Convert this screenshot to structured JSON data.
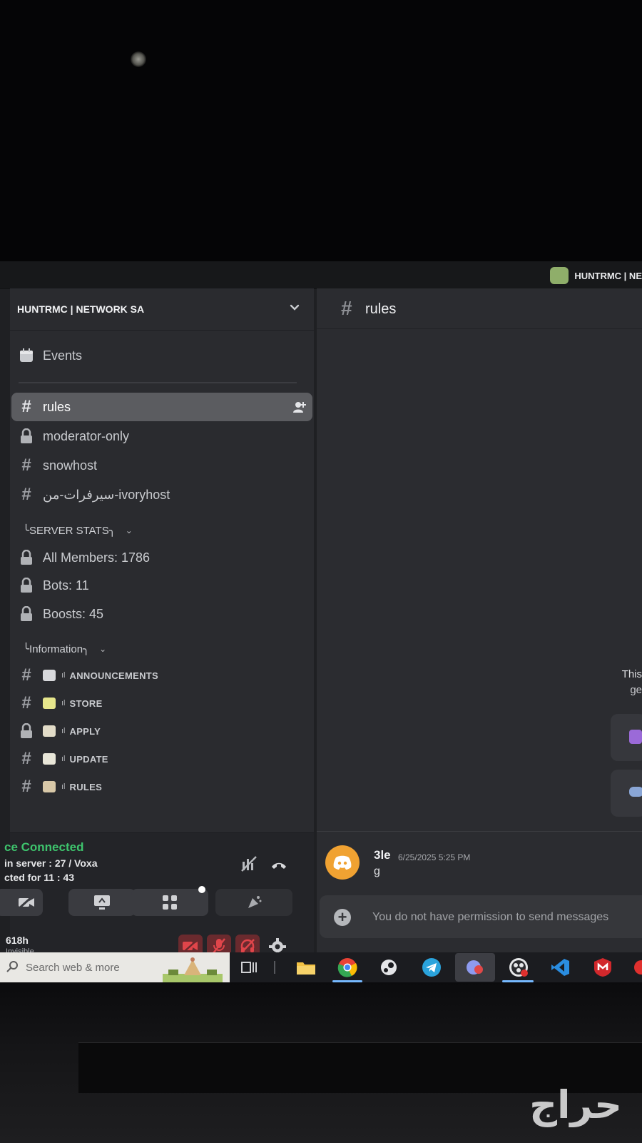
{
  "server": {
    "name": "HUNTRMC | NETWORK SA",
    "topbar_name": "HUNTRMC | NE"
  },
  "sidebar": {
    "events_label": "Events",
    "channels": [
      {
        "label": "rules",
        "icon": "hash-icon",
        "active": true
      },
      {
        "label": "moderator-only",
        "icon": "lock-icon"
      },
      {
        "label": "snowhost",
        "icon": "hash-icon"
      },
      {
        "label": "سيرفرات-من-ivoryhost",
        "icon": "hash-icon"
      }
    ],
    "categories": {
      "server_stats": "╰SERVER STATS╮",
      "information": "╰Information╮"
    },
    "stats": [
      {
        "label": "All Members: 1786",
        "icon": "lock-icon"
      },
      {
        "label": "Bots: 11",
        "icon": "lock-icon"
      },
      {
        "label": "Boosts: 45",
        "icon": "lock-icon"
      }
    ],
    "info_channels": [
      {
        "label": "ANNOUNCEMENTS",
        "icon": "hash-icon",
        "emoji": "megaphone-icon"
      },
      {
        "label": "STORE",
        "icon": "hash-icon",
        "emoji": "sparkle-icon"
      },
      {
        "label": "APPLY",
        "icon": "lock-icon",
        "emoji": "pencil-icon"
      },
      {
        "label": "UPDATE",
        "icon": "hash-icon",
        "emoji": "notepad-icon"
      },
      {
        "label": "RULES",
        "icon": "hash-icon",
        "emoji": "clipboard-icon"
      }
    ],
    "bars_glyph": "ıl"
  },
  "voice": {
    "title": "ce Connected",
    "subtitle": "in server : 27 / Voxa",
    "time": "cted for 11 : 43"
  },
  "user": {
    "name": "618h",
    "status": "Invisible"
  },
  "chat": {
    "channel": "rules",
    "welcome_fragment": "This",
    "welcome_fragment2": "ge",
    "message": {
      "author": "3le",
      "timestamp": "6/25/2025 5:25 PM",
      "body": "g"
    },
    "composer_placeholder": "You do not have permission to send messages"
  },
  "taskbar": {
    "search_placeholder": "Search web & more"
  },
  "watermark": "حراج",
  "colors": {
    "voice_connected": "#3ec46d",
    "avatar": "#f0a232",
    "mute_bg": "#6a2a2e",
    "active_channel": "#5b5c60"
  }
}
